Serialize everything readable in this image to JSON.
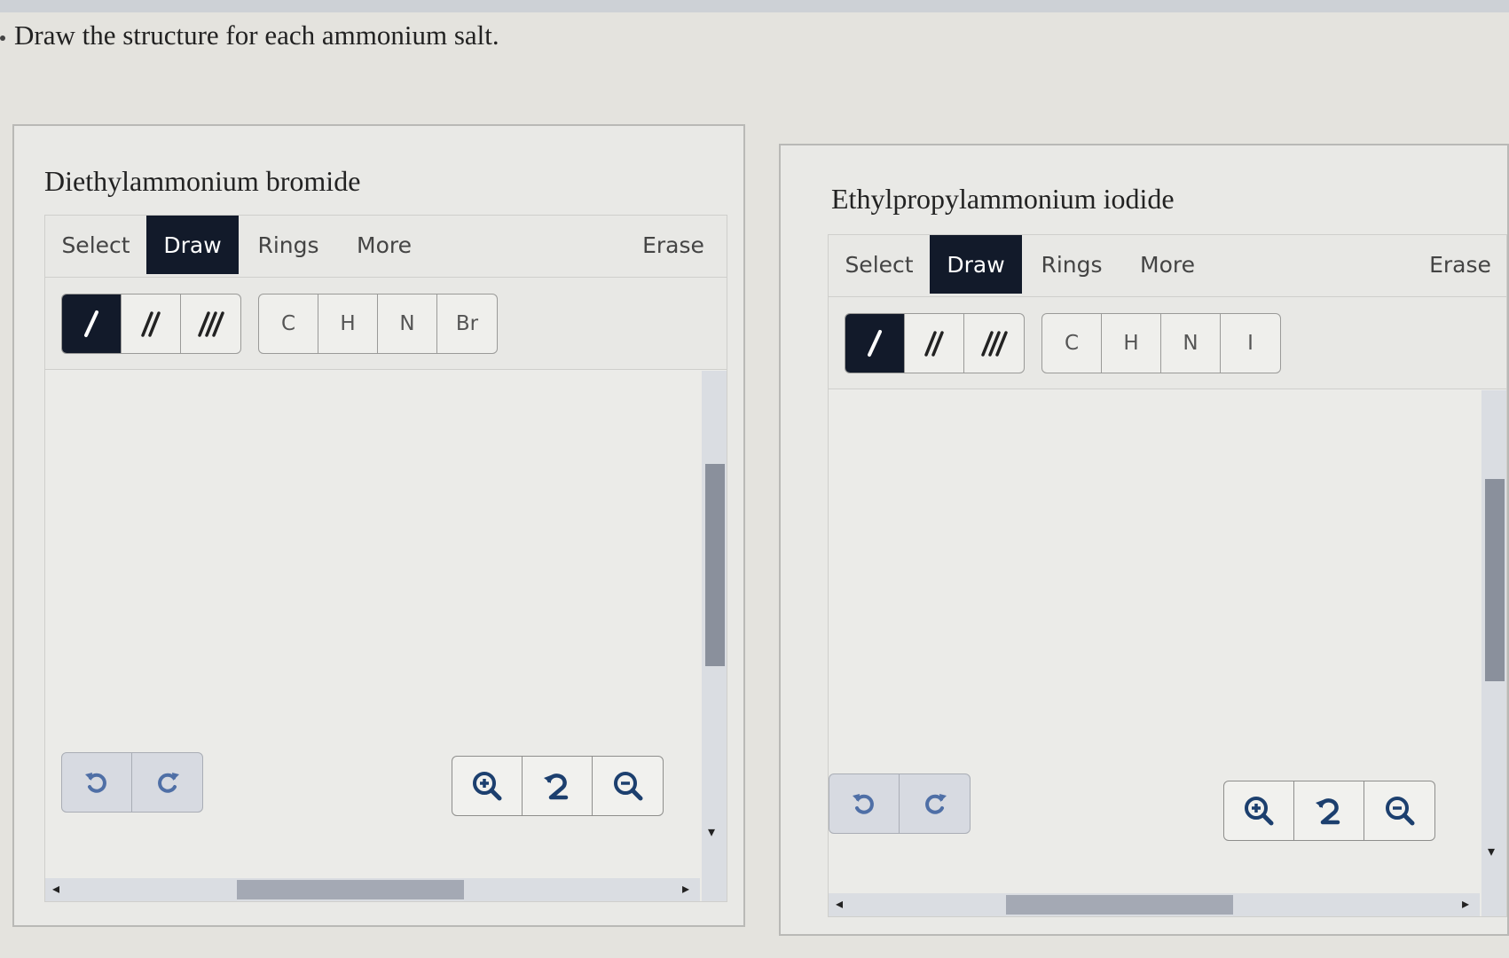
{
  "prompt": "Draw the structure for each ammonium salt.",
  "panels": [
    {
      "title": "Diethylammonium bromide",
      "tabs": {
        "select": "Select",
        "draw": "Draw",
        "rings": "Rings",
        "more": "More",
        "erase": "Erase"
      },
      "bond_tools": [
        "/",
        "//",
        "///"
      ],
      "atoms": [
        "C",
        "H",
        "N",
        "Br"
      ]
    },
    {
      "title": "Ethylpropylammonium iodide",
      "tabs": {
        "select": "Select",
        "draw": "Draw",
        "rings": "Rings",
        "more": "More",
        "erase": "Erase"
      },
      "bond_tools": [
        "/",
        "//",
        "///"
      ],
      "atoms": [
        "C",
        "H",
        "N",
        "I"
      ]
    }
  ],
  "active_tab": "Draw",
  "active_bond": "single",
  "icons": [
    "undo-icon",
    "redo-icon",
    "zoom-in-icon",
    "reset-zoom-icon",
    "zoom-out-icon"
  ],
  "colors": {
    "active_dark": "#121a2a",
    "icon_blue": "#1c3f6e",
    "faded_icon": "#4f6fa6"
  }
}
